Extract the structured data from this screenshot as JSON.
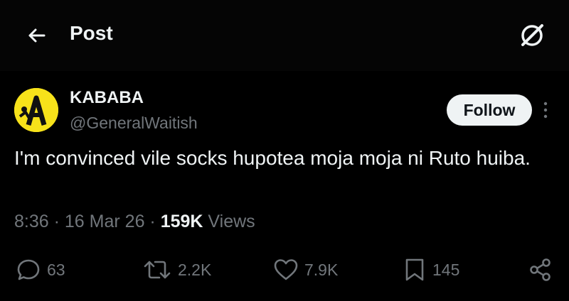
{
  "header": {
    "title": "Post",
    "back_icon": "arrow-left-icon",
    "grok_icon": "grok-icon"
  },
  "author": {
    "name": "KABABA",
    "handle": "@GeneralWaitish",
    "avatar_icon": "avatar-logo",
    "avatar_color": "#f7e21a"
  },
  "follow_label": "Follow",
  "tweet": {
    "text": "I'm convinced vile socks hupotea moja moja ni Ruto huiba."
  },
  "meta": {
    "time": "8:36",
    "separator": "·",
    "date": "16 Mar 26",
    "views_count": "159K",
    "views_label": "Views"
  },
  "actions": {
    "replies": "63",
    "reposts": "2.2K",
    "likes": "7.9K",
    "bookmarks": "145"
  },
  "colors": {
    "background": "#000000",
    "text": "#eff3f4",
    "muted": "#71767b"
  }
}
